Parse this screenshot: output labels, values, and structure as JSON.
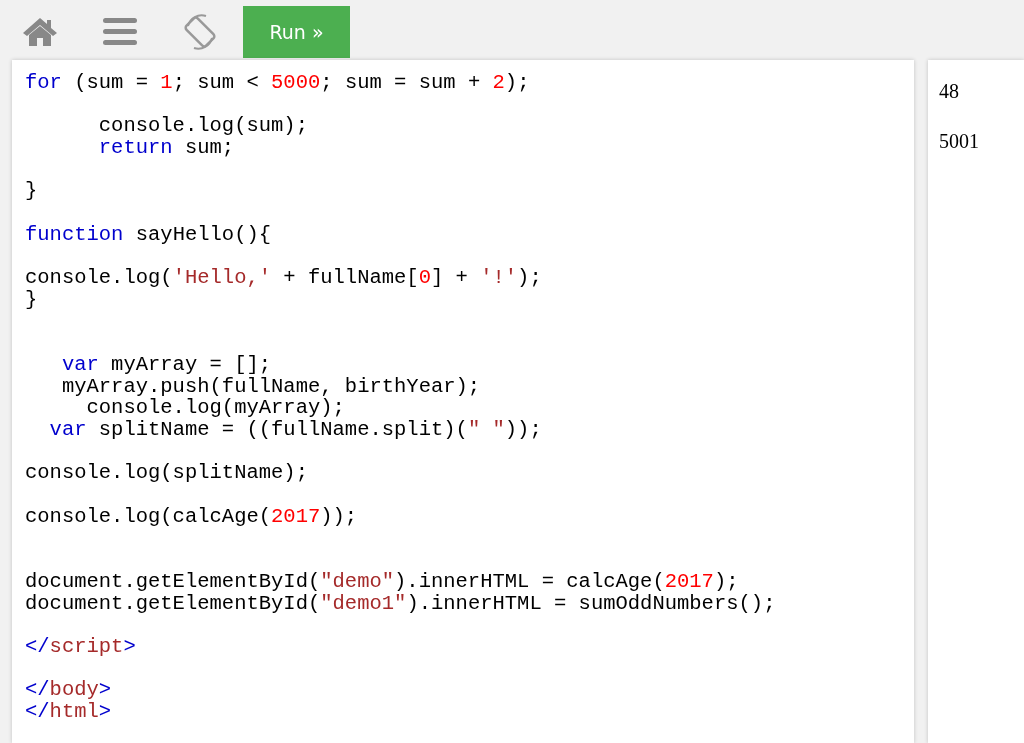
{
  "toolbar": {
    "run_button": "Run »"
  },
  "code_lines": [
    {
      "kind": "code",
      "tokens": [
        {
          "t": "for",
          "kind": "keyword"
        },
        {
          "t": " (sum = ",
          "kind": "plain"
        },
        {
          "t": "1",
          "kind": "number"
        },
        {
          "t": "; sum < ",
          "kind": "plain"
        },
        {
          "t": "5000",
          "kind": "number"
        },
        {
          "t": "; sum = sum + ",
          "kind": "plain"
        },
        {
          "t": "2",
          "kind": "number"
        },
        {
          "t": ");",
          "kind": "plain"
        }
      ]
    },
    {
      "kind": "blank"
    },
    {
      "kind": "code",
      "tokens": [
        {
          "t": "      console.log(sum);",
          "kind": "plain"
        }
      ]
    },
    {
      "kind": "code",
      "tokens": [
        {
          "t": "      return",
          "kind": "keyword"
        },
        {
          "t": " sum;",
          "kind": "plain"
        }
      ]
    },
    {
      "kind": "blank"
    },
    {
      "kind": "code",
      "tokens": [
        {
          "t": "}",
          "kind": "plain"
        }
      ]
    },
    {
      "kind": "blank"
    },
    {
      "kind": "code",
      "tokens": [
        {
          "t": "function",
          "kind": "keyword"
        },
        {
          "t": " sayHello(){",
          "kind": "plain"
        }
      ]
    },
    {
      "kind": "blank"
    },
    {
      "kind": "code",
      "tokens": [
        {
          "t": "console.log(",
          "kind": "plain"
        },
        {
          "t": "'Hello,'",
          "kind": "string"
        },
        {
          "t": " + fullName[",
          "kind": "plain"
        },
        {
          "t": "0",
          "kind": "number"
        },
        {
          "t": "] + ",
          "kind": "plain"
        },
        {
          "t": "'!'",
          "kind": "string"
        },
        {
          "t": ");",
          "kind": "plain"
        }
      ]
    },
    {
      "kind": "code",
      "tokens": [
        {
          "t": "}",
          "kind": "plain"
        }
      ]
    },
    {
      "kind": "blank"
    },
    {
      "kind": "blank"
    },
    {
      "kind": "code",
      "tokens": [
        {
          "t": "   var",
          "kind": "keyword"
        },
        {
          "t": " myArray = [];",
          "kind": "plain"
        }
      ]
    },
    {
      "kind": "code",
      "tokens": [
        {
          "t": "   myArray.push(fullName, birthYear);",
          "kind": "plain"
        }
      ]
    },
    {
      "kind": "code",
      "tokens": [
        {
          "t": "     console.log(myArray);",
          "kind": "plain"
        }
      ]
    },
    {
      "kind": "code",
      "tokens": [
        {
          "t": "  var",
          "kind": "keyword"
        },
        {
          "t": " splitName = ((fullName.split)(",
          "kind": "plain"
        },
        {
          "t": "\" \"",
          "kind": "string"
        },
        {
          "t": "));",
          "kind": "plain"
        }
      ]
    },
    {
      "kind": "blank"
    },
    {
      "kind": "code",
      "tokens": [
        {
          "t": "console.log(splitName);",
          "kind": "plain"
        }
      ]
    },
    {
      "kind": "blank"
    },
    {
      "kind": "code",
      "tokens": [
        {
          "t": "console.log(calcAge(",
          "kind": "plain"
        },
        {
          "t": "2017",
          "kind": "number"
        },
        {
          "t": "));",
          "kind": "plain"
        }
      ]
    },
    {
      "kind": "blank"
    },
    {
      "kind": "blank"
    },
    {
      "kind": "code",
      "tokens": [
        {
          "t": "document.getElementById(",
          "kind": "plain"
        },
        {
          "t": "\"demo\"",
          "kind": "string"
        },
        {
          "t": ").innerHTML = calcAge(",
          "kind": "plain"
        },
        {
          "t": "2017",
          "kind": "number"
        },
        {
          "t": ");",
          "kind": "plain"
        }
      ]
    },
    {
      "kind": "code",
      "tokens": [
        {
          "t": "document.getElementById(",
          "kind": "plain"
        },
        {
          "t": "\"demo1\"",
          "kind": "string"
        },
        {
          "t": ").innerHTML = sumOddNumbers();",
          "kind": "plain"
        }
      ]
    },
    {
      "kind": "blank"
    },
    {
      "kind": "code",
      "tokens": [
        {
          "t": "</",
          "kind": "tagmark"
        },
        {
          "t": "script",
          "kind": "tag"
        },
        {
          "t": ">",
          "kind": "tagmark"
        }
      ]
    },
    {
      "kind": "blank"
    },
    {
      "kind": "code",
      "tokens": [
        {
          "t": "</",
          "kind": "tagmark"
        },
        {
          "t": "body",
          "kind": "tag"
        },
        {
          "t": ">",
          "kind": "tagmark"
        }
      ]
    },
    {
      "kind": "code",
      "tokens": [
        {
          "t": "</",
          "kind": "tagmark"
        },
        {
          "t": "html",
          "kind": "tag"
        },
        {
          "t": ">",
          "kind": "tagmark"
        }
      ]
    }
  ],
  "result": {
    "lines": [
      "48",
      "5001"
    ]
  }
}
